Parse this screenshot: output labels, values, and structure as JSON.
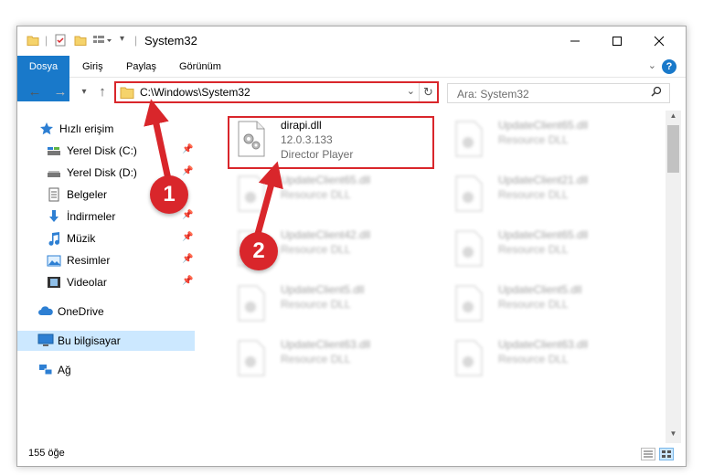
{
  "window": {
    "title": "System32"
  },
  "ribbon": {
    "tabs": [
      "Dosya",
      "Giriş",
      "Paylaş",
      "Görünüm"
    ]
  },
  "address_bar": {
    "path": "C:\\Windows\\System32",
    "search_placeholder": "Ara: System32"
  },
  "nav_pane": {
    "items": [
      {
        "label": "Hızlı erişim",
        "icon": "star-icon"
      },
      {
        "label": "Yerel Disk (C:)",
        "icon": "drive-icon"
      },
      {
        "label": "Yerel Disk (D:)",
        "icon": "drive-icon"
      },
      {
        "label": "Belgeler",
        "icon": "documents-icon"
      },
      {
        "label": "İndirmeler",
        "icon": "download-icon"
      },
      {
        "label": "Müzik",
        "icon": "music-icon"
      },
      {
        "label": "Resimler",
        "icon": "pictures-icon"
      },
      {
        "label": "Videolar",
        "icon": "videos-icon"
      },
      {
        "label": "OneDrive",
        "icon": "cloud-icon"
      },
      {
        "label": "Bu bilgisayar",
        "icon": "computer-icon"
      },
      {
        "label": "Ağ",
        "icon": "network-icon"
      }
    ],
    "selected": "Bu bilgisayar"
  },
  "files": [
    {
      "name": "dirapi.dll",
      "line2": "12.0.3.133",
      "line3": "Director Player",
      "blurred": false
    },
    {
      "name": "UpdateClient65.dll",
      "line2": "Resource DLL",
      "blurred": true
    },
    {
      "name": "UpdateClient65.dll",
      "line2": "Resource DLL",
      "blurred": true
    },
    {
      "name": "UpdateClient21.dll",
      "line2": "Resource DLL",
      "blurred": true
    },
    {
      "name": "UpdateClient42.dll",
      "line2": "Resource DLL",
      "blurred": true
    },
    {
      "name": "UpdateClient65.dll",
      "line2": "Resource DLL",
      "blurred": true
    },
    {
      "name": "UpdateClient5.dll",
      "line2": "Resource DLL",
      "blurred": true
    },
    {
      "name": "UpdateClient5.dll",
      "line2": "Resource DLL",
      "blurred": true
    },
    {
      "name": "UpdateClient63.dll",
      "line2": "Resource DLL",
      "blurred": true
    },
    {
      "name": "UpdateClient63.dll",
      "line2": "Resource DLL",
      "blurred": true
    }
  ],
  "status": {
    "item_count": "155 öğe"
  },
  "annotations": [
    "1",
    "2"
  ],
  "colors": {
    "accent": "#1979ca",
    "highlight": "#d9262b",
    "selection": "#cce8ff"
  }
}
